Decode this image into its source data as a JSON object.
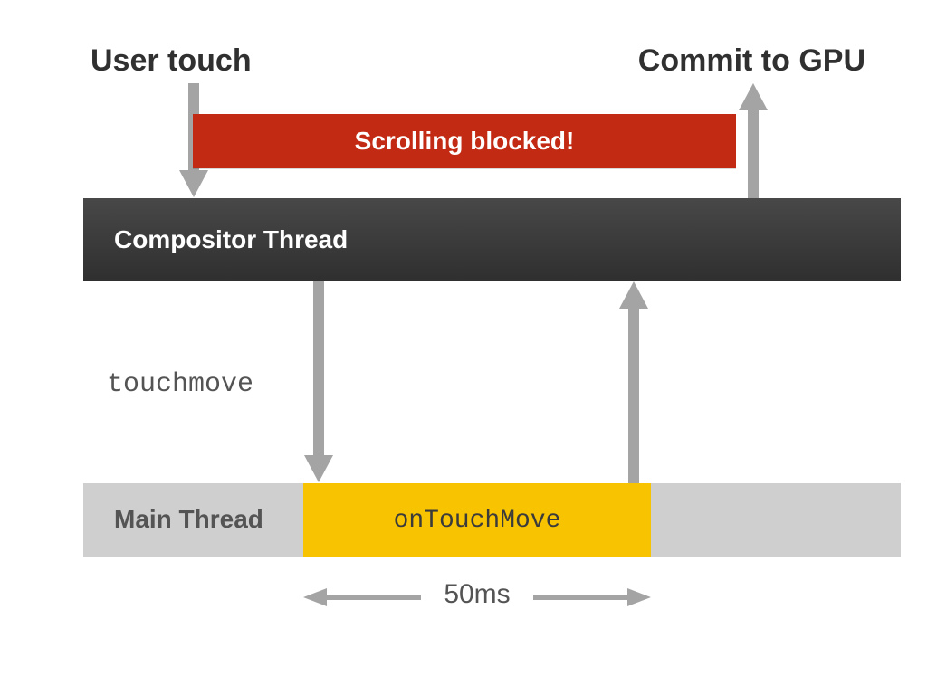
{
  "labels": {
    "user_touch": "User touch",
    "commit_gpu": "Commit to GPU",
    "blocked": "Scrolling blocked!",
    "compositor": "Compositor Thread",
    "touchmove": "touchmove",
    "main_thread": "Main Thread",
    "ontouchmove": "onTouchMove",
    "duration": "50ms"
  },
  "colors": {
    "blocked": "#c32a13",
    "yellow": "#f8c300",
    "arrow": "#a4a4a4",
    "thread_bg": "#cfcfcf"
  },
  "diagram": {
    "sequence": [
      {
        "from": "user-touch",
        "to": "compositor-thread",
        "via": "arrow-down"
      },
      {
        "from": "compositor-thread",
        "to": "main-thread",
        "event": "touchmove",
        "via": "arrow-down"
      },
      {
        "from": "main-thread",
        "handler": "onTouchMove",
        "duration_ms": 50
      },
      {
        "from": "main-thread",
        "to": "compositor-thread",
        "via": "arrow-up"
      },
      {
        "from": "compositor-thread",
        "to": "commit-to-gpu",
        "via": "arrow-up"
      }
    ],
    "blocked_span": {
      "while": "onTouchMove",
      "message": "Scrolling blocked!"
    }
  }
}
